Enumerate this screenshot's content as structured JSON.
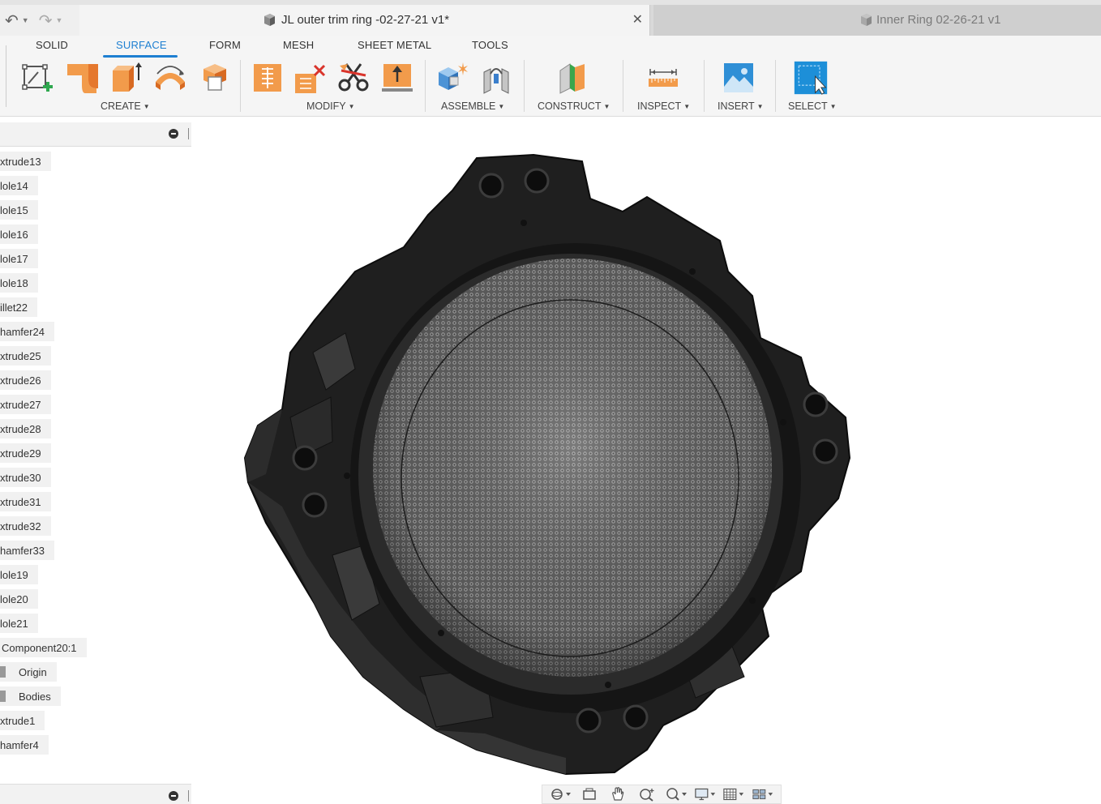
{
  "tabs": {
    "active_title": "JL outer trim ring -02-27-21 v1*",
    "close_glyph": "✕",
    "inactive_title": "Inner Ring 02-26-21 v1"
  },
  "quick_access": {
    "undo_icon": "undo-icon",
    "redo_icon": "redo-icon"
  },
  "workspace_tabs": [
    "SOLID",
    "SURFACE",
    "FORM",
    "MESH",
    "SHEET METAL",
    "TOOLS"
  ],
  "active_workspace": "SURFACE",
  "toolbar_groups": [
    {
      "label": "CREATE",
      "tools": [
        "create-sketch-icon",
        "extrude-icon",
        "extrude-body-icon",
        "revolve-icon",
        "offset-icon"
      ]
    },
    {
      "label": "MODIFY",
      "tools": [
        "press-pull-icon",
        "trim-icon",
        "split-icon",
        "stitch-icon"
      ]
    },
    {
      "label": "ASSEMBLE",
      "tools": [
        "new-component-icon",
        "joint-icon"
      ]
    },
    {
      "label": "CONSTRUCT",
      "tools": [
        "offset-plane-icon"
      ]
    },
    {
      "label": "INSPECT",
      "tools": [
        "measure-icon"
      ]
    },
    {
      "label": "INSERT",
      "tools": [
        "insert-image-icon"
      ]
    },
    {
      "label": "SELECT",
      "tools": [
        "select-icon"
      ]
    }
  ],
  "browser": {
    "items": [
      "xtrude13",
      "lole14",
      "lole15",
      "lole16",
      "lole17",
      "lole18",
      "illet22",
      "hamfer24",
      "xtrude25",
      "xtrude26",
      "xtrude27",
      "xtrude28",
      "xtrude29",
      "xtrude30",
      "xtrude31",
      "xtrude32",
      "hamfer33",
      "lole19",
      "lole20",
      "lole21",
      "Component20:1",
      "Origin",
      "Bodies",
      "xtrude1",
      "hamfer4"
    ]
  },
  "nav_tools": [
    "orbit-icon",
    "look-at-icon",
    "pan-icon",
    "zoom-icon",
    "fit-icon",
    "display-settings-icon",
    "grid-icon",
    "viewports-icon"
  ],
  "colors": {
    "accent": "#1d7fd1",
    "model_body": "#2a2a2a",
    "mesh_surface": "#7a7a7a"
  }
}
